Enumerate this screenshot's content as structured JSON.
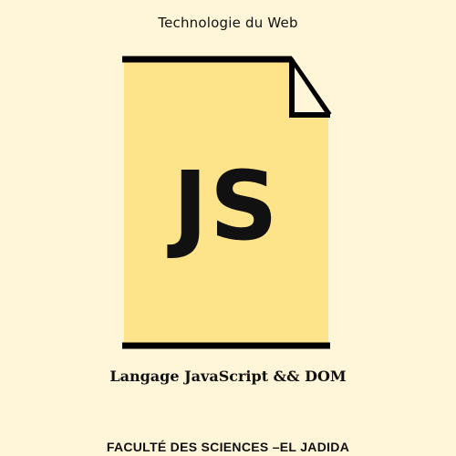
{
  "header": {
    "title": "Technologie du Web"
  },
  "icon": {
    "name": "js-file-icon",
    "label": "JS",
    "fill_color": "#fde48a",
    "stroke_color": "#000000"
  },
  "subtitle": "Langage JavaScript && DOM",
  "footer": {
    "institution": "FACULTÉ DES SCIENCES –EL JADIDA"
  },
  "colors": {
    "background": "#fff5d8",
    "text": "#111111"
  }
}
